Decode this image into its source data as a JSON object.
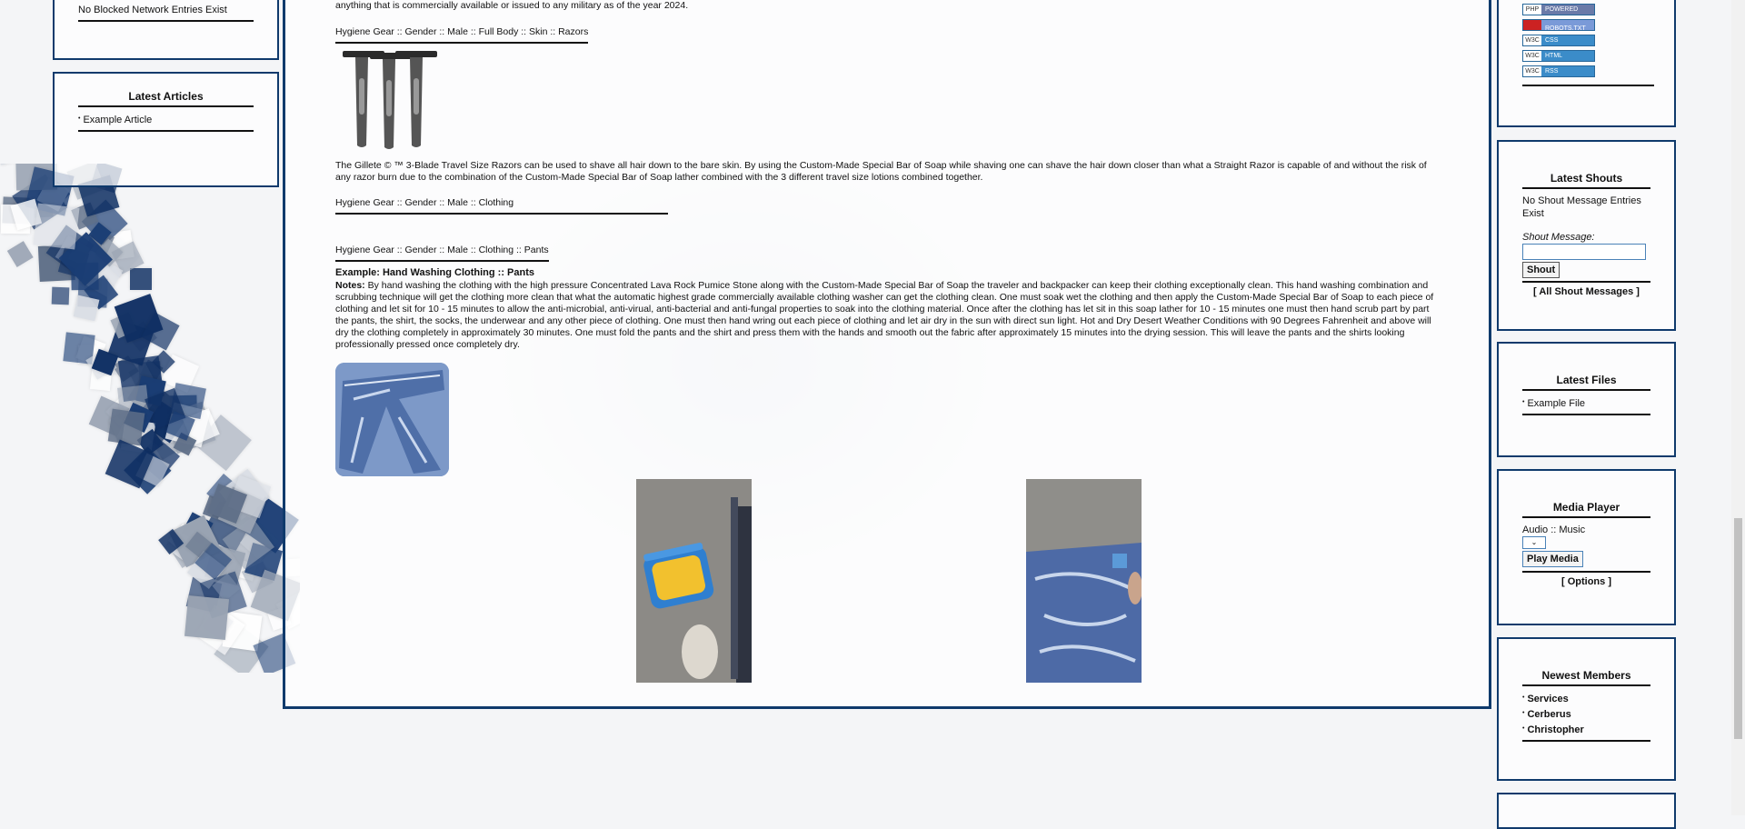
{
  "left": {
    "blocked_text": "No Blocked Network Entries Exist",
    "latest_articles": {
      "title": "Latest Articles",
      "items": [
        "Example Article"
      ]
    }
  },
  "main": {
    "top_text": "anything that is commercially available or issued to any military as of the year 2024.",
    "crumb_razors": "Hygiene Gear :: Gender :: Male :: Full Body :: Skin :: Razors",
    "razor_text": "The Gillete © ™ 3-Blade Travel Size Razors can be used to shave all hair down to the bare skin. By using the Custom-Made Special Bar of Soap while shaving one can shave the hair down closer than what a Straight Razor is capable of and without the risk of any razor burn due to the combination of the Custom-Made Special Bar of Soap lather combined with the 3 different travel size lotions combined together.",
    "crumb_clothing": "Hygiene Gear :: Gender :: Male :: Clothing",
    "crumb_pants": "Hygiene Gear :: Gender :: Male :: Clothing :: Pants",
    "example_title": "Example: Hand Washing Clothing :: Pants",
    "notes_label": "Notes:",
    "notes_text": " By hand washing the clothing with the high pressure Concentrated Lava Rock Pumice Stone along with the Custom-Made Special Bar of Soap the traveler and backpacker can keep their clothing exceptionally clean. This hand washing combination and scrubbing technique will get the clothing more clean that what the automatic highest grade commercially available clothing washer can get the clothing clean. One must soak wet the clothing and then apply the Custom-Made Special Bar of Soap to each piece of clothing and let sit for 10 - 15 minutes to allow the anti-microbial, anti-virual, anti-bacterial and anti-fungal properties to soak into the clothing material. Once after the clothing has let sit in this soap lather for 10 - 15 minutes one must then hand scrub part by part the pants, the shirt, the socks, the underwear and any other piece of clothing. One must then hand wring out each piece of clothing and let air dry in the sun with direct sun light. Hot and Dry Desert Weather Conditions with 90 Degrees Fahrenheit and above will dry the clothing completely in approximately 30 minutes. One must fold the pants and the shirt and press them with the hands and smooth out the fabric after approximately 15 minutes into the drying session. This will leave the pants and the shirts looking professionally pressed once completely dry."
  },
  "right": {
    "badges": [
      {
        "left": "PHP",
        "right": "POWERED"
      },
      {
        "left": "",
        "right": "ROBOTS.TXT"
      },
      {
        "left": "W3C",
        "right": "CSS"
      },
      {
        "left": "W3C",
        "right": "HTML"
      },
      {
        "left": "W3C",
        "right": "RSS"
      }
    ],
    "shouts": {
      "title": "Latest Shouts",
      "empty": "No Shout Message Entries Exist",
      "label": "Shout Message:",
      "button": "Shout",
      "all_link": "[ All Shout Messages ]"
    },
    "files": {
      "title": "Latest Files",
      "items": [
        "Example File"
      ]
    },
    "media": {
      "title": "Media Player",
      "category": "Audio :: Music",
      "select_value": "",
      "play_button": "Play Media",
      "options_link": "[ Options ]"
    },
    "members": {
      "title": "Newest Members",
      "items": [
        "Services",
        "Cerberus",
        "Christopher"
      ]
    }
  },
  "colors": {
    "frame": "#0f3a6c",
    "badge_blue": "#3b8cc9"
  }
}
